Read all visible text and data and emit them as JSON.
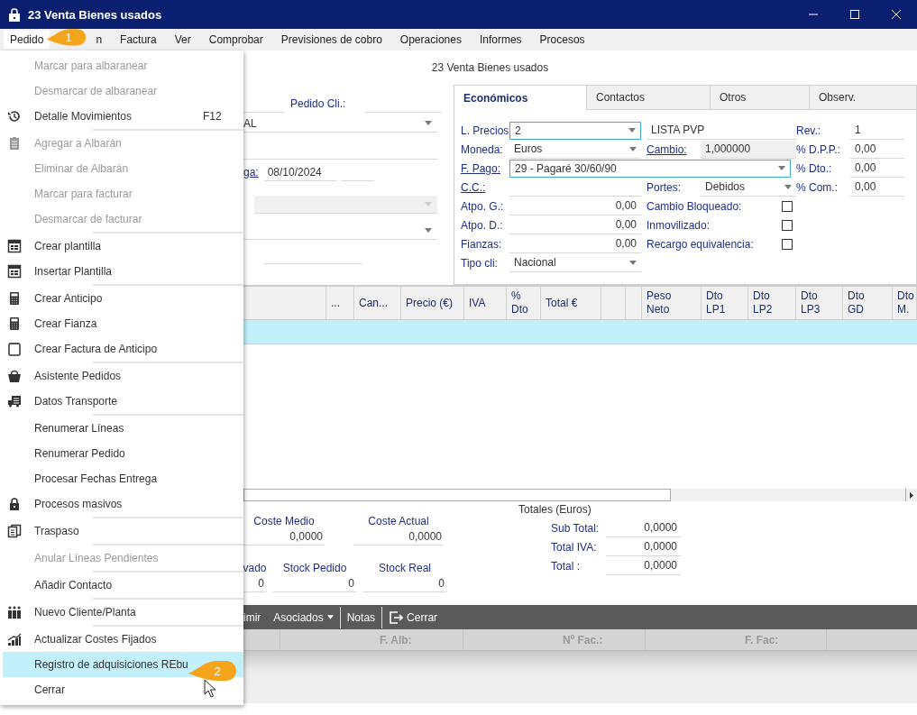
{
  "window": {
    "title": "23 Venta Bienes usados"
  },
  "menubar": [
    {
      "label": "Pedido",
      "selected": true
    },
    {
      "label": "n",
      "selected": false
    },
    {
      "label": "Factura",
      "selected": false
    },
    {
      "label": "Ver",
      "selected": false
    },
    {
      "label": "Comprobar",
      "selected": false
    },
    {
      "label": "Previsiones de cobro",
      "selected": false
    },
    {
      "label": "Operaciones",
      "selected": false
    },
    {
      "label": "Informes",
      "selected": false
    },
    {
      "label": "Procesos",
      "selected": false
    }
  ],
  "heading": "23 Venta Bienes usados",
  "order_form": {
    "rows": [
      [
        {
          "kind": "field"
        },
        {
          "kind": "label",
          "text": "Pedido Cli.:"
        },
        {
          "kind": "field"
        }
      ],
      [
        {
          "kind": "select",
          "value": "AL"
        }
      ],
      [
        {
          "kind": "field"
        }
      ],
      [
        {
          "kind": "link",
          "text": "ga:"
        },
        {
          "kind": "field",
          "value": "08/10/2024"
        },
        {
          "kind": "field"
        }
      ],
      [
        {
          "kind": "select",
          "disabled": true
        }
      ],
      [
        {
          "kind": "select",
          "disabled": false
        }
      ],
      [
        {
          "kind": "field"
        }
      ]
    ]
  },
  "tabs": [
    {
      "label": "Económicos",
      "selected": true
    },
    {
      "label": "Contactos",
      "selected": false
    },
    {
      "label": "Otros",
      "selected": false
    },
    {
      "label": "Observ.",
      "selected": false
    }
  ],
  "economicos": {
    "rows": [
      [
        {
          "kind": "label",
          "text": "L. Precios"
        },
        {
          "kind": "select",
          "value": "2",
          "focused": true
        },
        {
          "kind": "caption",
          "value": "LISTA PVP"
        },
        "",
        {
          "kind": "label",
          "text": "Rev.:"
        },
        {
          "kind": "text",
          "value": "1"
        }
      ],
      [
        {
          "kind": "label",
          "text": "Moneda:"
        },
        {
          "kind": "select",
          "value": "Euros",
          "focused": false
        },
        {
          "kind": "link",
          "text": "Cambio:"
        },
        {
          "kind": "readonly",
          "value": "1,000000"
        },
        {
          "kind": "label",
          "text": "% D.P.P.:"
        },
        {
          "kind": "text",
          "value": "0,00"
        }
      ],
      [
        {
          "kind": "link",
          "text": "F. Pago:"
        },
        {
          "kind": "wide_select",
          "value": "29 - Pagaré 30/60/90",
          "focused": true
        },
        "",
        "",
        {
          "kind": "label",
          "text": "% Dto.:"
        },
        {
          "kind": "text",
          "value": "0,00"
        }
      ],
      [
        {
          "kind": "link",
          "text": "C.C.:"
        },
        {
          "kind": "text"
        },
        {
          "kind": "label",
          "text": "Portes:"
        },
        {
          "kind": "select",
          "value": "Debidos",
          "focused": false
        },
        {
          "kind": "label",
          "text": "% Com.:"
        },
        {
          "kind": "text",
          "value": "0,00"
        }
      ],
      [
        {
          "kind": "label",
          "text": "Atpo. G.:"
        },
        {
          "kind": "number",
          "value": "0,00"
        },
        {
          "kind": "check",
          "text": "Cambio Bloqueado:",
          "checked": false
        }
      ],
      [
        {
          "kind": "label",
          "text": "Atpo. D.:"
        },
        {
          "kind": "number",
          "value": "0,00"
        },
        {
          "kind": "check",
          "text": "Inmovilizado:",
          "checked": false
        }
      ],
      [
        {
          "kind": "label",
          "text": "Fianzas:"
        },
        {
          "kind": "number",
          "value": "0,00"
        },
        {
          "kind": "check",
          "text": "Recargo equivalencia:",
          "checked": false
        }
      ],
      [
        {
          "kind": "label",
          "text": "Tipo cli:"
        },
        {
          "kind": "select",
          "value": "Nacional",
          "focused": false
        }
      ]
    ]
  },
  "grid": {
    "columns": [
      {},
      {
        "label": "..."
      },
      {
        "label": "Can..."
      },
      {
        "label": "Precio (€)"
      },
      {
        "label": "IVA"
      },
      {
        "label": "%\nDto"
      },
      {
        "label": "Total €"
      },
      {},
      {},
      {
        "label": "Peso\nNeto"
      },
      {
        "label": "Dto\nLP1"
      },
      {
        "label": "Dto\nLP2"
      },
      {
        "label": "Dto\nLP3"
      },
      {
        "label": "Dto\nGD"
      },
      {
        "label": "Dto\nM."
      }
    ],
    "rows": [
      {
        "selected": true
      }
    ]
  },
  "costs": [
    {
      "label": "Coste Medio",
      "value": "0,0000"
    },
    {
      "label": "Coste Actual",
      "value": "0,0000"
    }
  ],
  "stock": [
    {
      "label": "vado",
      "value": "0"
    },
    {
      "label": "Stock Pedido",
      "value": "0"
    },
    {
      "label": "Stock Real",
      "value": "0"
    }
  ],
  "totals": {
    "title": "Totales (Euros)",
    "rows": [
      {
        "label": "Sub Total:",
        "value": "0,0000"
      },
      {
        "label": "Total IVA:",
        "value": "0,0000"
      },
      {
        "label": "Total :",
        "value": "0,0000"
      }
    ]
  },
  "toolbar": [
    {
      "label": "imir",
      "kind": "button"
    },
    {
      "label": "Asociados",
      "kind": "dropdown"
    },
    {
      "label": "Notas",
      "kind": "button"
    },
    {
      "label": "Cerrar",
      "kind": "exit"
    }
  ],
  "lower_columns": [
    {},
    {
      "label": "F. Alb:"
    },
    {
      "label": "Nº Fac.:"
    },
    {
      "label": "F. Fac:"
    },
    {}
  ],
  "menu": {
    "groups": [
      [
        {
          "label": "Marcar para albaranear",
          "kind": "plain",
          "disabled": true,
          "selected": false
        },
        {
          "label": "Desmarcar de albaranear",
          "kind": "plain",
          "disabled": true,
          "selected": false
        },
        {
          "label": "Detalle Movimientos",
          "shortcut": "F12",
          "kind": "history",
          "disabled": false,
          "selected": false
        }
      ],
      [
        {
          "label": "Agregar a Albarán",
          "kind": "clipboard",
          "disabled": true,
          "selected": false
        },
        {
          "label": "Eliminar de Albarán",
          "kind": "plain",
          "disabled": true,
          "selected": false
        },
        {
          "label": "Marcar para facturar",
          "kind": "plain",
          "disabled": true,
          "selected": false
        },
        {
          "label": "Desmarcar de facturar",
          "kind": "plain",
          "disabled": true,
          "selected": false
        }
      ],
      [
        {
          "label": "Crear plantilla",
          "kind": "template",
          "disabled": false,
          "selected": false
        },
        {
          "label": "Insertar Plantilla",
          "kind": "template",
          "disabled": false,
          "selected": false
        }
      ],
      [
        {
          "label": "Crear Anticipo",
          "kind": "calculator",
          "disabled": false,
          "selected": false
        },
        {
          "label": "Crear Fianza",
          "kind": "calculator",
          "disabled": false,
          "selected": false
        },
        {
          "label": "Crear Factura de Anticipo",
          "kind": "notebook",
          "disabled": false,
          "selected": false
        }
      ],
      [
        {
          "label": "Asistente Pedidos",
          "kind": "basket",
          "disabled": false,
          "selected": false
        },
        {
          "label": "Datos Transporte",
          "kind": "truck",
          "disabled": false,
          "selected": false
        }
      ],
      [
        {
          "label": "Renumerar Líneas",
          "kind": "plain",
          "disabled": false,
          "selected": false
        },
        {
          "label": "Renumerar Pedido",
          "kind": "plain",
          "disabled": false,
          "selected": false
        },
        {
          "label": "Procesar Fechas Entrega",
          "kind": "plain",
          "disabled": false,
          "selected": false
        },
        {
          "label": "Procesos masivos",
          "kind": "lock",
          "disabled": false,
          "selected": false
        }
      ],
      [
        {
          "label": "Traspaso",
          "kind": "copy",
          "disabled": false,
          "selected": false
        }
      ],
      [
        {
          "label": "Anular Líneas Pendientes",
          "kind": "plain",
          "disabled": true,
          "selected": false
        }
      ],
      [
        {
          "label": "Añadir Contacto",
          "kind": "plain",
          "disabled": false,
          "selected": false
        }
      ],
      [
        {
          "label": "Nuevo Cliente/Planta",
          "kind": "people",
          "disabled": false,
          "selected": false
        }
      ],
      [
        {
          "label": "Actualizar Costes Fijados",
          "kind": "chart",
          "disabled": false,
          "selected": false
        },
        {
          "label": "Registro de adquisiciones REbu",
          "kind": "plain",
          "disabled": false,
          "selected": true
        },
        {
          "label": "Cerrar",
          "kind": "plain",
          "disabled": false,
          "selected": false
        }
      ]
    ]
  },
  "callouts": [
    {
      "label": "1"
    },
    {
      "label": "2"
    }
  ]
}
